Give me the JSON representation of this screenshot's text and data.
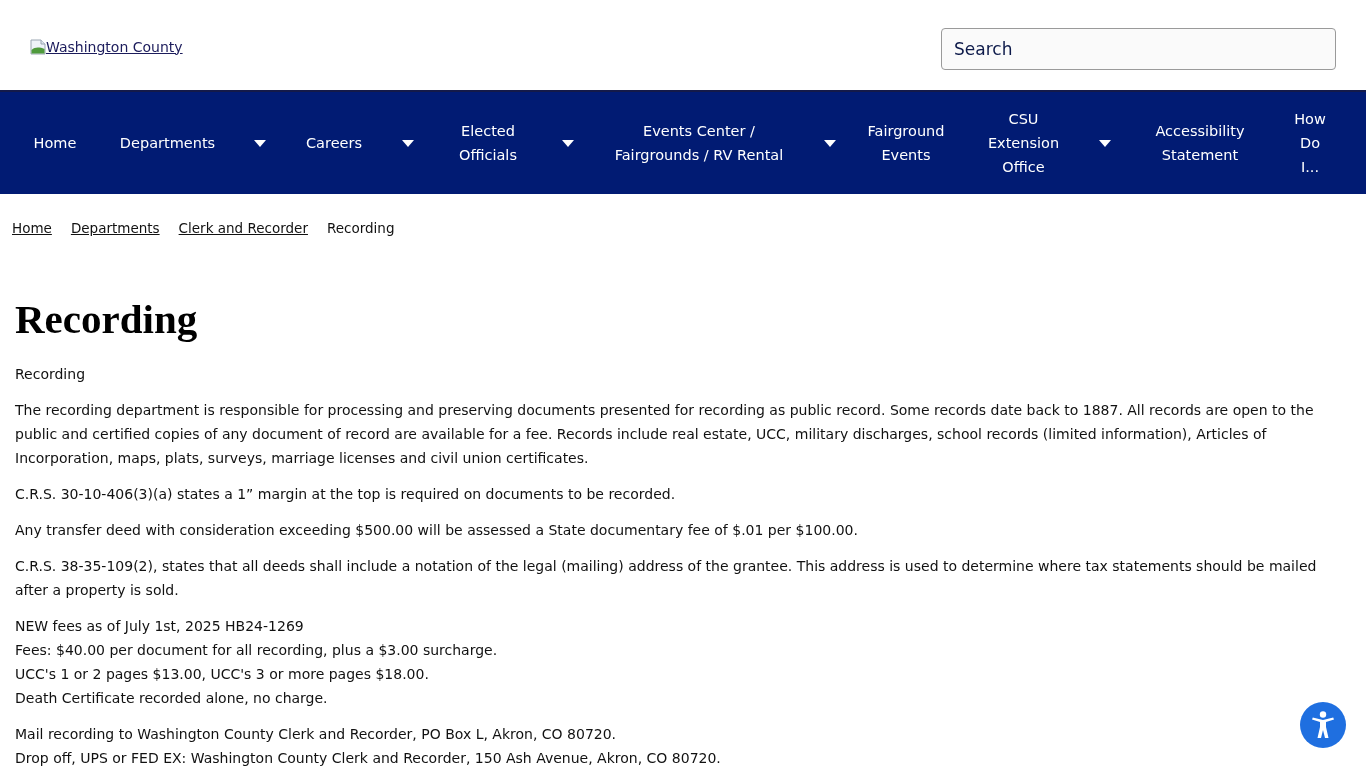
{
  "header": {
    "logo": {
      "alt_text": "Washington County"
    },
    "search": {
      "placeholder": "Search"
    }
  },
  "main_nav": [
    {
      "label": "Home",
      "has_dropdown": false
    },
    {
      "label": "Departments",
      "has_dropdown": true
    },
    {
      "label": "Careers",
      "has_dropdown": true
    },
    {
      "label": "Elected Officials",
      "has_dropdown": true
    },
    {
      "label": "Events Center / Fairgrounds / RV Rental",
      "has_dropdown": true
    },
    {
      "label": "Fairground Events",
      "has_dropdown": false
    },
    {
      "label": "CSU Extension Office",
      "has_dropdown": true
    },
    {
      "label": "Accessibility Statement",
      "has_dropdown": false
    },
    {
      "label": "How Do I...",
      "has_dropdown": false
    }
  ],
  "breadcrumb": [
    {
      "label": "Home",
      "current": false
    },
    {
      "label": "Departments",
      "current": false
    },
    {
      "label": "Clerk and Recorder",
      "current": false
    },
    {
      "label": "Recording",
      "current": true
    }
  ],
  "page_title": "Recording",
  "paragraphs": [
    {
      "lines": [
        "Recording"
      ]
    },
    {
      "lines": [
        "The recording department is responsible for processing and preserving documents presented for recording as public record. Some records date back to 1887. All records are open to the public and certified copies of any document of record are available for a fee. Records include real estate, UCC, military discharges, school records (limited information), Articles of Incorporation, maps, plats, surveys, marriage licenses and civil union certificates."
      ]
    },
    {
      "lines": [
        "C.R.S. 30-10-406(3)(a) states a 1” margin at the top is required on documents to be recorded."
      ]
    },
    {
      "lines": [
        "Any transfer deed with consideration exceeding $500.00 will be assessed a State documentary fee of $.01 per $100.00."
      ]
    },
    {
      "lines": [
        "C.R.S. 38-35-109(2), states that all deeds shall include a notation of the legal (mailing) address of the grantee. This address is used to determine where tax statements should be mailed after a property is sold."
      ]
    },
    {
      "lines": [
        "NEW fees as of July 1st, 2025 HB24-1269",
        "Fees: $40.00 per document for all recording, plus a $3.00 surcharge.",
        "UCC's 1 or 2 pages $13.00, UCC's 3 or more pages $18.00.",
        "Death Certificate recorded alone, no charge."
      ]
    },
    {
      "lines": [
        "Mail recording to Washington County Clerk and Recorder, PO Box L, Akron, CO 80720.",
        "Drop off, UPS or FED EX: Washington County Clerk and Recorder, 150 Ash Avenue, Akron, CO 80720."
      ]
    }
  ]
}
